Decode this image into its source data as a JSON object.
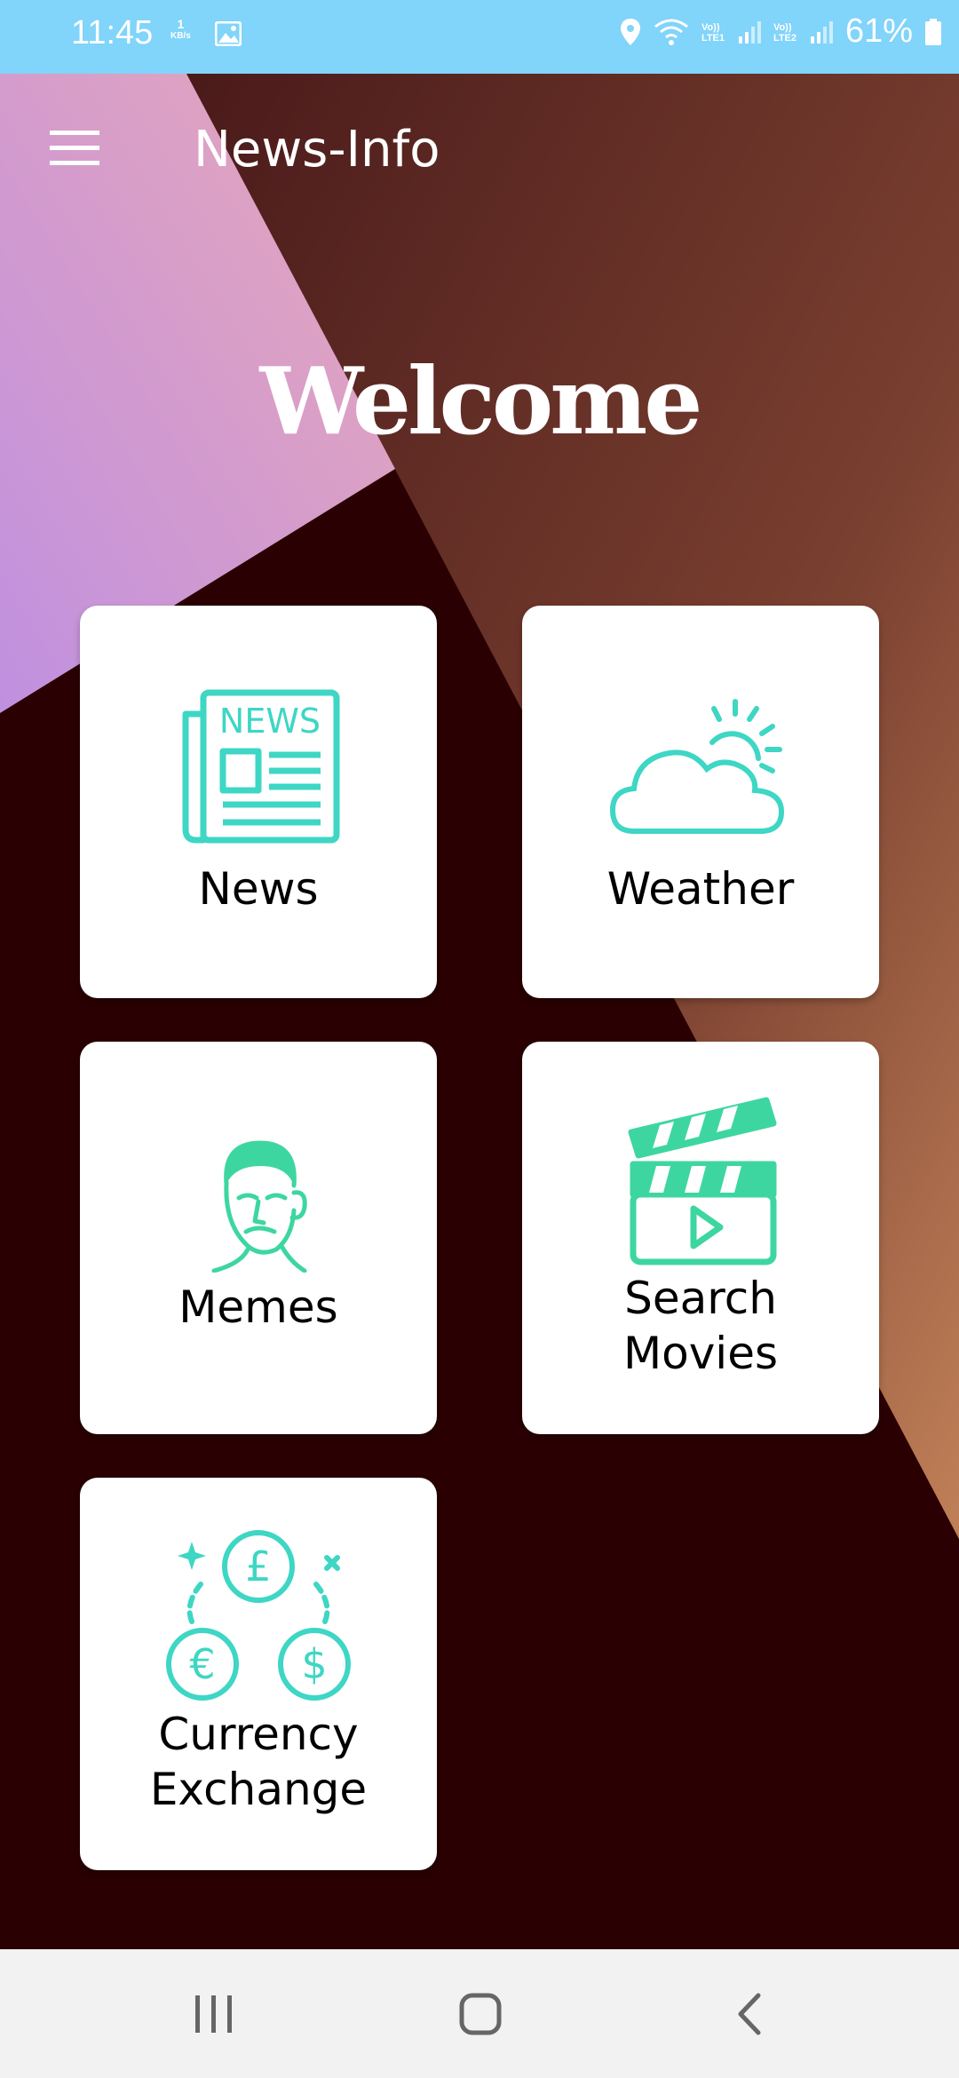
{
  "status_bar": {
    "time": "11:45",
    "net_speed_value": "1",
    "net_speed_unit": "KB/s",
    "sim1_label": "Vo)) LTE1",
    "sim2_label": "Vo)) LTE2",
    "battery_percent": "61%"
  },
  "app_bar": {
    "title": "News-Info",
    "menu_icon": "hamburger-menu-icon"
  },
  "main": {
    "heading": "Welcome",
    "tiles": [
      {
        "label_lines": [
          "News"
        ],
        "icon": "newspaper-icon",
        "icon_color": "#3ed6c4"
      },
      {
        "label_lines": [
          "Weather"
        ],
        "icon": "cloud-sun-icon",
        "icon_color": "#3ed6c4"
      },
      {
        "label_lines": [
          "Memes"
        ],
        "icon": "meme-face-icon",
        "icon_color": "#3ed6a0"
      },
      {
        "label_lines": [
          "Search",
          "Movies"
        ],
        "icon": "clapperboard-icon",
        "icon_color": "#3ed6a0"
      },
      {
        "label_lines": [
          "Currency",
          "Exchange"
        ],
        "icon": "currency-exchange-icon",
        "icon_color": "#3ed6c4"
      }
    ]
  },
  "nav_bar": {
    "recents_icon": "recents-icon",
    "home_icon": "home-icon",
    "back_icon": "back-icon"
  },
  "colors": {
    "status_bar": "#81d4fa",
    "background_dark": "#2a0002",
    "background_brown": "#5a2824",
    "background_light_brown": "#b07050",
    "background_purple": "#c090e0",
    "background_pink": "#e0a8c0",
    "tile_background": "#ffffff",
    "navbar": "#f2f2f2"
  }
}
